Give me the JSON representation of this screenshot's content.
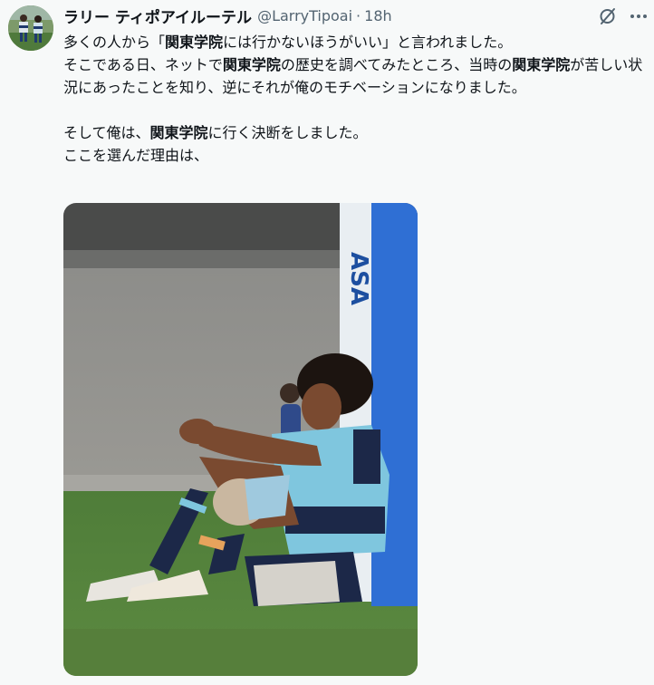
{
  "user": {
    "display_name": "ラリー ティポアイルーテル",
    "handle": "@LarryTipoai",
    "separator": "·",
    "timestamp": "18h",
    "avatar_icon": "rugby-players-avatar"
  },
  "actions": {
    "grok_icon": "grok-slash-circle-icon",
    "more_icon": "more-horizontal-icon"
  },
  "tweet": {
    "segments": [
      {
        "text": "多くの人から「",
        "bold": false
      },
      {
        "text": "関東学院",
        "bold": true
      },
      {
        "text": "には行かないほうがいい」と言われました。",
        "bold": false
      },
      {
        "text": "\n",
        "bold": false
      },
      {
        "text": "そこである日、ネットで",
        "bold": false
      },
      {
        "text": "関東学院",
        "bold": true
      },
      {
        "text": "の歴史を調べてみたところ、当時の",
        "bold": false
      },
      {
        "text": "関東学院",
        "bold": true
      },
      {
        "text": "が苦しい状況にあったことを知り、逆にそれが俺のモチベーションになりました。",
        "bold": false
      },
      {
        "text": "\n\n",
        "bold": false
      },
      {
        "text": "そして俺は、",
        "bold": false
      },
      {
        "text": "関東学院",
        "bold": true
      },
      {
        "text": "に行く決断をしました。",
        "bold": false
      },
      {
        "text": "\n",
        "bold": false
      },
      {
        "text": "ここを選んだ理由は、",
        "bold": false
      }
    ]
  },
  "media": {
    "description_icon": "rugby-player-photo",
    "post_pad_letters": "ASA"
  }
}
